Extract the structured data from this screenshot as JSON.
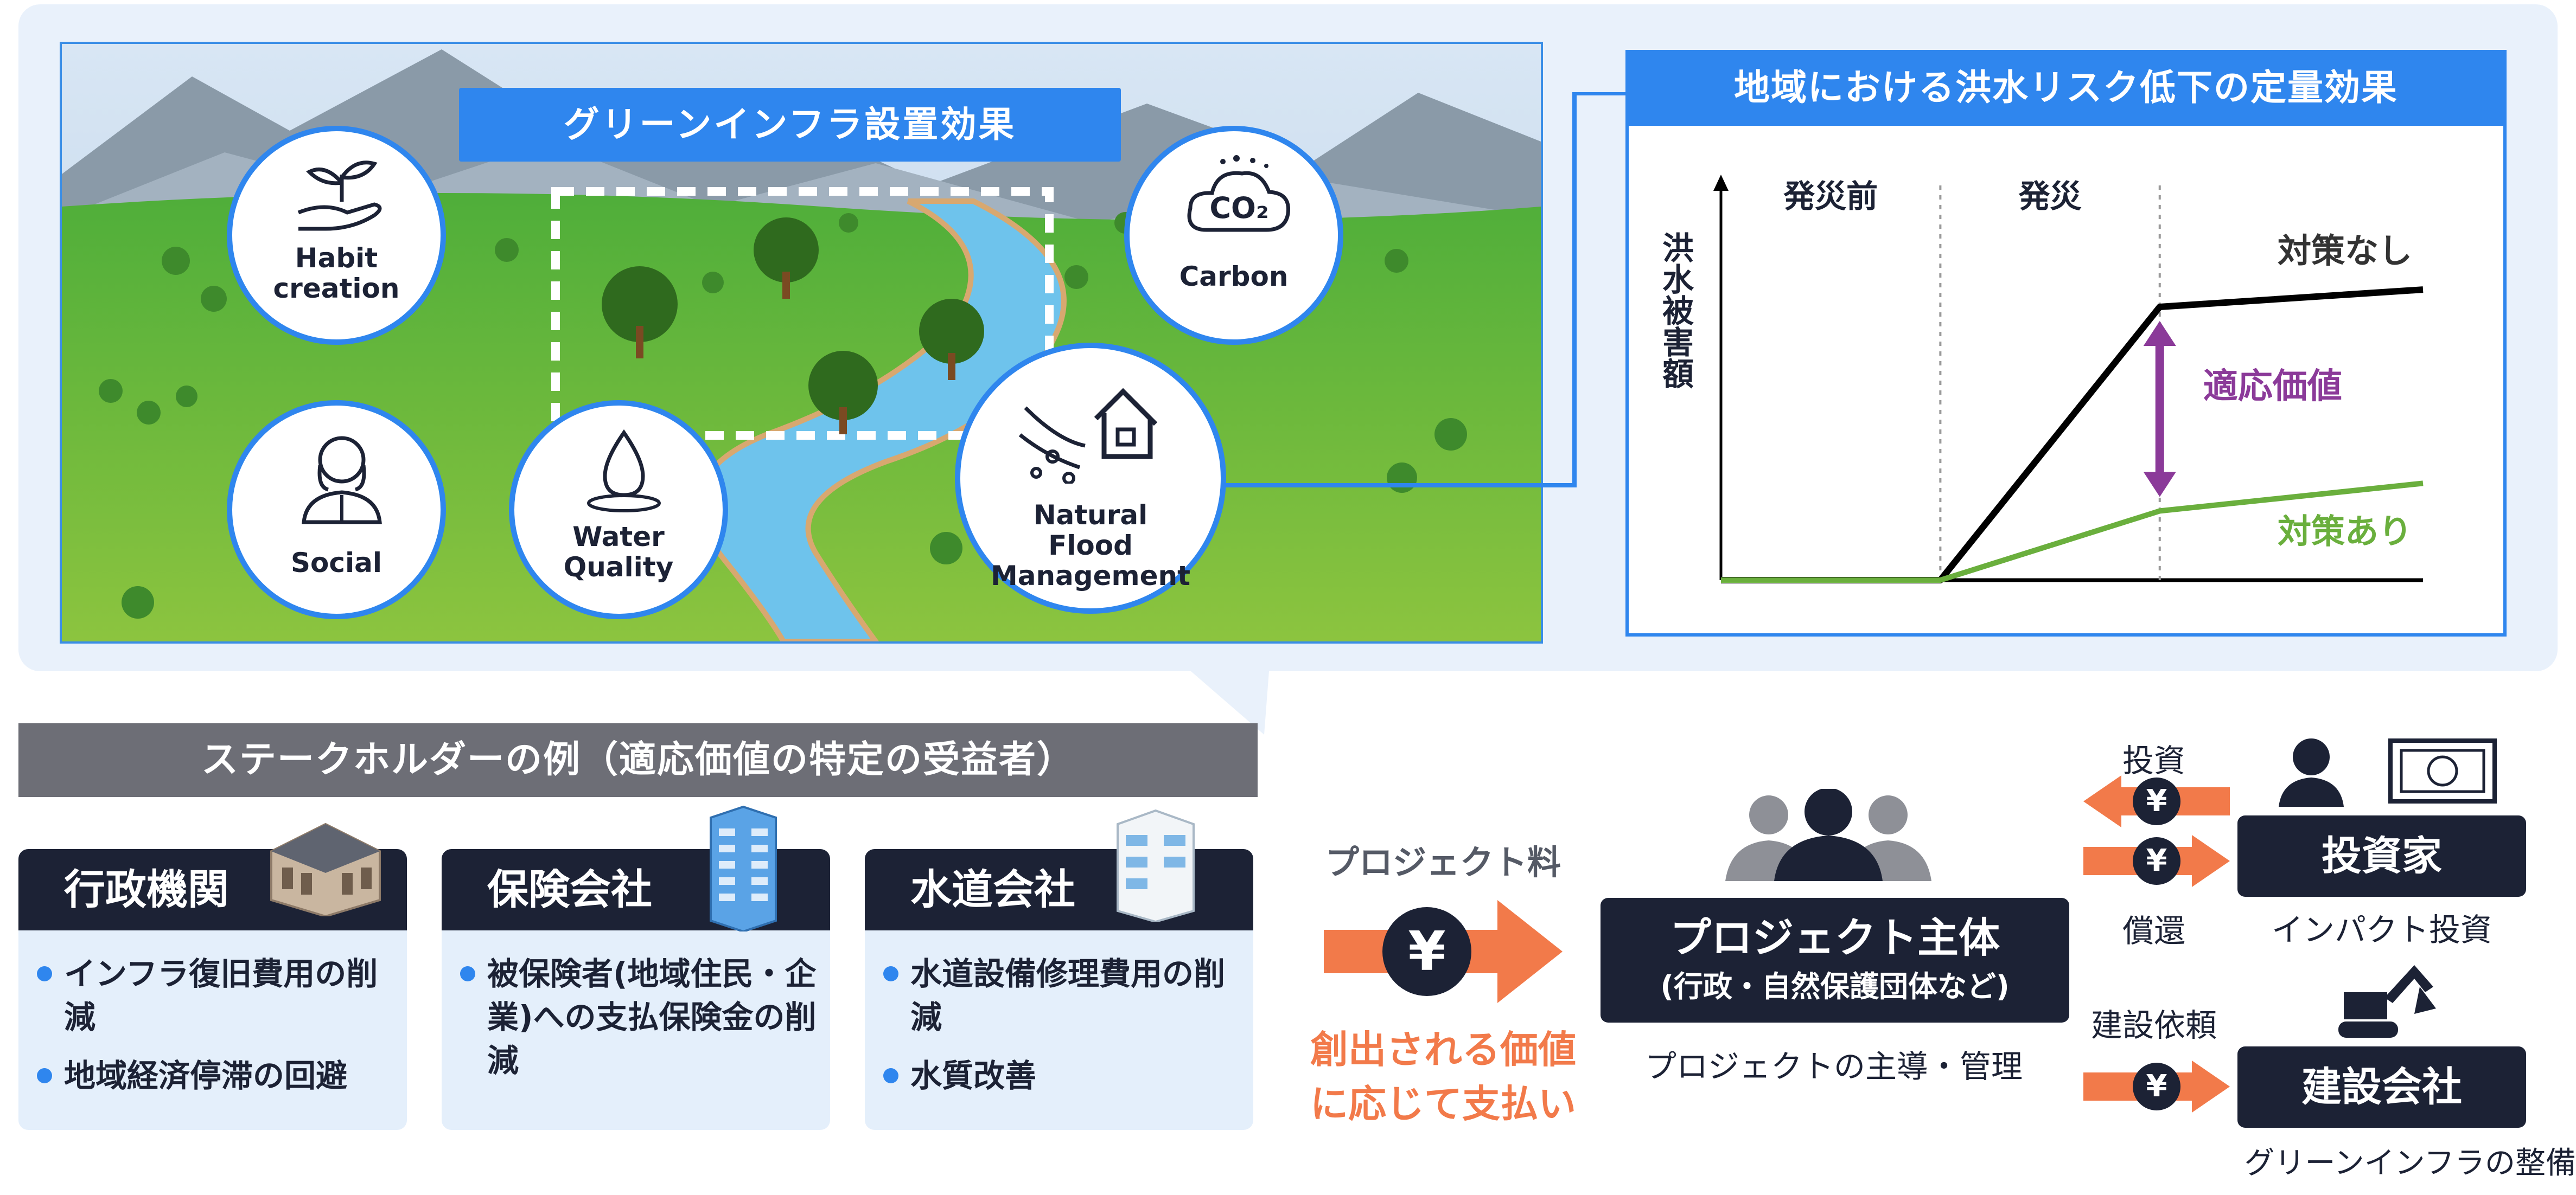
{
  "landscape": {
    "title": "グリーンインフラ設置効果",
    "circles": {
      "habit": "Habit creation",
      "carbon": "Carbon",
      "social": "Social",
      "water": "Water Quality",
      "flood": "Natural Flood Management"
    },
    "co2_text": "CO₂"
  },
  "chart_data": {
    "type": "line",
    "title": "地域における洪水リスク低下の定量効果",
    "ylabel": "洪水被害額",
    "phases": [
      "発災前",
      "発災"
    ],
    "annotation": "適応価値",
    "series": [
      {
        "name": "対策なし",
        "color": "#000000",
        "points": [
          [
            0,
            0
          ],
          [
            0.5,
            0
          ],
          [
            1.0,
            0.79
          ],
          [
            1.6,
            0.84
          ]
        ]
      },
      {
        "name": "対策あり",
        "color": "#6aaf3d",
        "points": [
          [
            0,
            0
          ],
          [
            0.5,
            0
          ],
          [
            1.0,
            0.2
          ],
          [
            1.6,
            0.28
          ]
        ]
      }
    ],
    "annotation_color": "#8b3a99"
  },
  "stakeholders": {
    "header": "ステークホルダーの例（適応価値の特定の受益者）",
    "cards": [
      {
        "title": "行政機関",
        "items": [
          "インフラ復旧費用の削減",
          "地域経済停滞の回避"
        ]
      },
      {
        "title": "保険会社",
        "items": [
          "被保険者(地域住民・企業)への支払保険金の削減"
        ]
      },
      {
        "title": "水道会社",
        "items": [
          "水道設備修理費用の削減",
          "水質改善"
        ]
      }
    ]
  },
  "flow": {
    "fee_label": "プロジェクト料",
    "yen": "¥",
    "pay_line1": "創出される価値",
    "pay_line2": "に応じて支払い",
    "project_title": "プロジェクト主体",
    "project_sub": "(行政・自然保護団体など)",
    "project_caption": "プロジェクトの主導・管理",
    "invest_label": "投資",
    "repay_label": "償還",
    "construct_label": "建設依頼",
    "investor_title": "投資家",
    "investor_caption": "インパクト投資",
    "builder_title": "建設会社",
    "builder_caption": "グリーンインフラの整備"
  },
  "colors": {
    "accent_blue": "#2f86ee",
    "navy": "#1c2235",
    "orange": "#f27a4a",
    "purple": "#8b3a99",
    "green": "#6aaf3d"
  }
}
